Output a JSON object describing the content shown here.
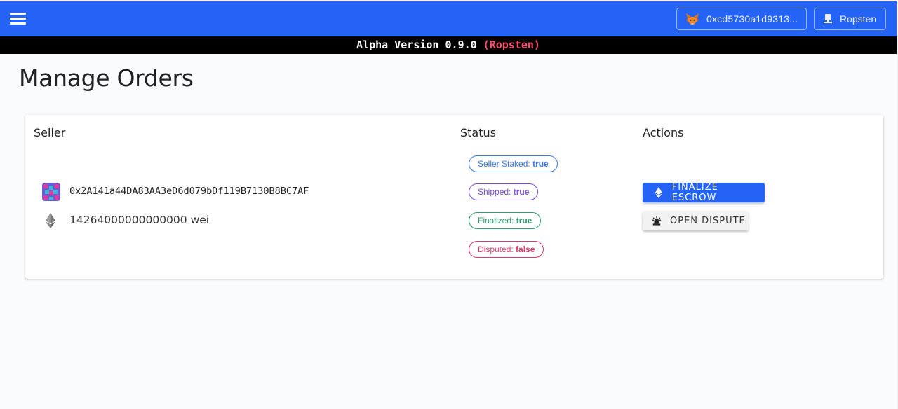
{
  "appbar": {
    "wallet_address": "0xcd5730a1d9313...",
    "network_label": "Ropsten",
    "accent": "#2563f6"
  },
  "banner": {
    "version_text": "Alpha Version 0.9.0",
    "network_text": "(Ropsten)"
  },
  "page": {
    "title": "Manage Orders"
  },
  "table": {
    "headers": {
      "seller": "Seller",
      "status": "Status",
      "actions": "Actions"
    },
    "order": {
      "seller_address": "0x2A141a44DA83AA3eD6d079bDf119B7130B8BC7AF",
      "amount": "14264000000000000 wei",
      "statuses": [
        {
          "label": "Seller Staked:",
          "value": "true",
          "color": "#3a78e6"
        },
        {
          "label": "Shipped:",
          "value": "true",
          "color": "#7c4ddb"
        },
        {
          "label": "Finalized:",
          "value": "true",
          "color": "#2aa06c"
        },
        {
          "label": "Disputed:",
          "value": "false",
          "color": "#e0386a"
        }
      ],
      "actions": {
        "finalize_label": "Finalize Escrow",
        "dispute_label": "Open Dispute"
      }
    }
  },
  "icons": {
    "menu": "hamburger-icon",
    "wallet": "metamask-fox-icon",
    "network": "network-icon",
    "seller": "identicon-avatar",
    "amount": "ethereum-icon",
    "finalize": "ethereum-icon",
    "dispute": "alarm-siren-icon"
  }
}
